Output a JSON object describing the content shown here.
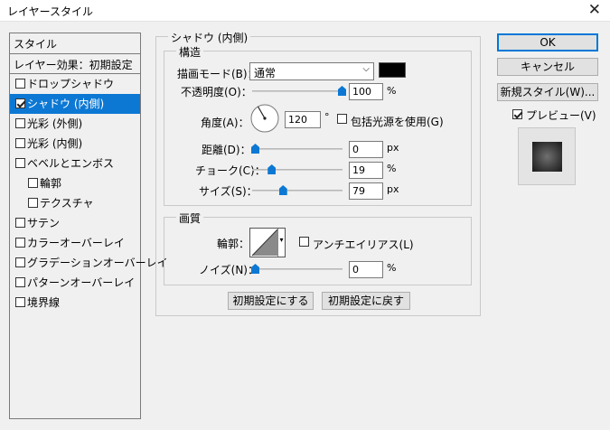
{
  "window": {
    "title": "レイヤースタイル"
  },
  "style_list": {
    "header": "スタイル",
    "subheader": "レイヤー効果：初期設定",
    "items": [
      {
        "label": "ドロップシャドウ",
        "checked": false,
        "selected": false,
        "indent": false
      },
      {
        "label": "シャドウ (内側)",
        "checked": true,
        "selected": true,
        "indent": false
      },
      {
        "label": "光彩 (外側)",
        "checked": false,
        "selected": false,
        "indent": false
      },
      {
        "label": "光彩 (内側)",
        "checked": false,
        "selected": false,
        "indent": false
      },
      {
        "label": "ベベルとエンボス",
        "checked": false,
        "selected": false,
        "indent": false
      },
      {
        "label": "輪郭",
        "checked": false,
        "selected": false,
        "indent": true
      },
      {
        "label": "テクスチャ",
        "checked": false,
        "selected": false,
        "indent": true
      },
      {
        "label": "サテン",
        "checked": false,
        "selected": false,
        "indent": false
      },
      {
        "label": "カラーオーバーレイ",
        "checked": false,
        "selected": false,
        "indent": false
      },
      {
        "label": "グラデーションオーバーレイ",
        "checked": false,
        "selected": false,
        "indent": false
      },
      {
        "label": "パターンオーバーレイ",
        "checked": false,
        "selected": false,
        "indent": false
      },
      {
        "label": "境界線",
        "checked": false,
        "selected": false,
        "indent": false
      }
    ]
  },
  "inner_shadow": {
    "group_title": "シャドウ (内側)",
    "structure": {
      "title": "構造",
      "blend_mode": {
        "label": "描画モード(B)：",
        "value": "通常",
        "color": "#000000"
      },
      "opacity": {
        "label": "不透明度(O)：",
        "value": "100",
        "unit": "%",
        "fraction": 1.0
      },
      "angle": {
        "label": "角度(A)：",
        "value": "120",
        "unit": "°",
        "global_light_label": "包括光源を使用(G)",
        "global_light_checked": false
      },
      "distance": {
        "label": "距離(D)：",
        "value": "0",
        "unit": "px",
        "fraction": 0.0
      },
      "choke": {
        "label": "チョーク(C)：",
        "value": "19",
        "unit": "%",
        "fraction": 0.19
      },
      "size": {
        "label": "サイズ(S)：",
        "value": "79",
        "unit": "px",
        "fraction": 0.32
      }
    },
    "quality": {
      "title": "画質",
      "contour": {
        "label": "輪郭：",
        "anti_alias_label": "アンチエイリアス(L)",
        "anti_alias_checked": false
      },
      "noise": {
        "label": "ノイズ(N)：",
        "value": "0",
        "unit": "%",
        "fraction": 0.0
      }
    },
    "make_default_label": "初期設定にする",
    "reset_default_label": "初期設定に戻す"
  },
  "buttons": {
    "ok": "OK",
    "cancel": "キャンセル",
    "new_style": "新規スタイル(W)...",
    "preview_label": "プレビュー(V)",
    "preview_checked": true
  },
  "colors": {
    "accent": "#0c78d4"
  }
}
